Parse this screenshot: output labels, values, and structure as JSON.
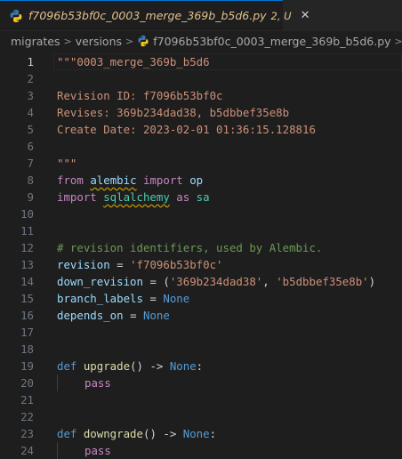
{
  "colors": {
    "accent": "#0078d4",
    "modified": "#e2c08d",
    "background": "#1e1e1e"
  },
  "tab": {
    "icon": "python-icon",
    "filename": "f7096b53bf0c_0003_merge_369b_b5d6.py",
    "status": "2, U",
    "close_glyph": "✕"
  },
  "breadcrumb": {
    "items": [
      "migrates",
      "versions"
    ],
    "file": "f7096b53bf0c_0003_merge_369b_b5d6.py",
    "more": "..."
  },
  "editor": {
    "lines": [
      {
        "n": "1",
        "parts": [
          {
            "t": "\"\"\"0003_merge_369b_b5d6",
            "c": "str"
          }
        ]
      },
      {
        "n": "2",
        "parts": []
      },
      {
        "n": "3",
        "parts": [
          {
            "t": "Revision ID: f7096b53bf0c",
            "c": "str"
          }
        ]
      },
      {
        "n": "4",
        "parts": [
          {
            "t": "Revises: 369b234dad38, b5dbbef35e8b",
            "c": "str"
          }
        ]
      },
      {
        "n": "5",
        "parts": [
          {
            "t": "Create Date: 2023-02-01 01:36:15.128816",
            "c": "str"
          }
        ]
      },
      {
        "n": "6",
        "parts": []
      },
      {
        "n": "7",
        "parts": [
          {
            "t": "\"\"\"",
            "c": "str"
          }
        ]
      },
      {
        "n": "8",
        "parts": [
          {
            "t": "from ",
            "c": "kw"
          },
          {
            "t": "alembic",
            "c": "var",
            "sq": true
          },
          {
            "t": " import ",
            "c": "kw"
          },
          {
            "t": "op",
            "c": "var"
          }
        ]
      },
      {
        "n": "9",
        "parts": [
          {
            "t": "import ",
            "c": "kw"
          },
          {
            "t": "sqlalchemy",
            "c": "mod",
            "sq": true
          },
          {
            "t": " as ",
            "c": "kw"
          },
          {
            "t": "sa",
            "c": "mod"
          }
        ]
      },
      {
        "n": "10",
        "parts": []
      },
      {
        "n": "11",
        "parts": []
      },
      {
        "n": "12",
        "parts": [
          {
            "t": "# revision identifiers, used by Alembic.",
            "c": "cm"
          }
        ]
      },
      {
        "n": "13",
        "parts": [
          {
            "t": "revision",
            "c": "var"
          },
          {
            "t": " = ",
            "c": "op"
          },
          {
            "t": "'f7096b53bf0c'",
            "c": "str"
          }
        ]
      },
      {
        "n": "14",
        "parts": [
          {
            "t": "down_revision",
            "c": "var"
          },
          {
            "t": " = (",
            "c": "op"
          },
          {
            "t": "'369b234dad38'",
            "c": "str"
          },
          {
            "t": ", ",
            "c": "op"
          },
          {
            "t": "'b5dbbef35e8b'",
            "c": "str"
          },
          {
            "t": ")",
            "c": "op"
          }
        ]
      },
      {
        "n": "15",
        "parts": [
          {
            "t": "branch_labels",
            "c": "var"
          },
          {
            "t": " = ",
            "c": "op"
          },
          {
            "t": "None",
            "c": "kwb"
          }
        ]
      },
      {
        "n": "16",
        "parts": [
          {
            "t": "depends_on",
            "c": "var"
          },
          {
            "t": " = ",
            "c": "op"
          },
          {
            "t": "None",
            "c": "kwb"
          }
        ]
      },
      {
        "n": "17",
        "parts": []
      },
      {
        "n": "18",
        "parts": []
      },
      {
        "n": "19",
        "parts": [
          {
            "t": "def ",
            "c": "kwb"
          },
          {
            "t": "upgrade",
            "c": "fn"
          },
          {
            "t": "() -> ",
            "c": "op"
          },
          {
            "t": "None",
            "c": "kwb"
          },
          {
            "t": ":",
            "c": "op"
          }
        ]
      },
      {
        "n": "20",
        "indent": true,
        "parts": [
          {
            "t": "pass",
            "c": "kw"
          }
        ]
      },
      {
        "n": "21",
        "parts": []
      },
      {
        "n": "22",
        "parts": []
      },
      {
        "n": "23",
        "parts": [
          {
            "t": "def ",
            "c": "kwb"
          },
          {
            "t": "downgrade",
            "c": "fn"
          },
          {
            "t": "() -> ",
            "c": "op"
          },
          {
            "t": "None",
            "c": "kwb"
          },
          {
            "t": ":",
            "c": "op"
          }
        ]
      },
      {
        "n": "24",
        "indent": true,
        "parts": [
          {
            "t": "pass",
            "c": "kw"
          }
        ]
      }
    ]
  }
}
